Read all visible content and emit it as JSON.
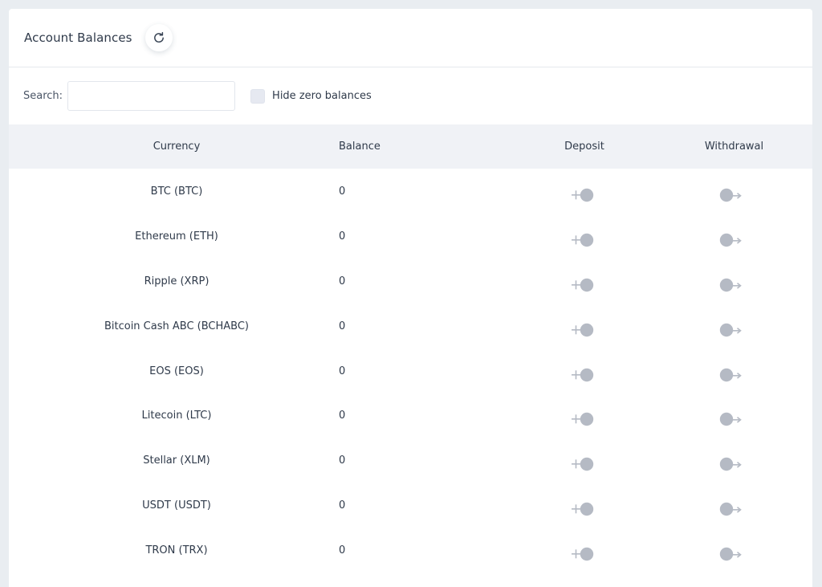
{
  "header": {
    "title": "Account Balances",
    "refresh_icon": "refresh-icon"
  },
  "filters": {
    "search_label": "Search:",
    "search_value": "",
    "search_placeholder": "",
    "hide_zero_label": "Hide zero balances",
    "hide_zero_checked": false
  },
  "table": {
    "columns": [
      "Currency",
      "Balance",
      "Deposit",
      "Withdrawal"
    ],
    "rows": [
      {
        "currency": "BTC (BTC)",
        "balance": "0"
      },
      {
        "currency": "Ethereum (ETH)",
        "balance": "0"
      },
      {
        "currency": "Ripple (XRP)",
        "balance": "0"
      },
      {
        "currency": "Bitcoin Cash ABC (BCHABC)",
        "balance": "0"
      },
      {
        "currency": "EOS (EOS)",
        "balance": "0"
      },
      {
        "currency": "Litecoin (LTC)",
        "balance": "0"
      },
      {
        "currency": "Stellar (XLM)",
        "balance": "0"
      },
      {
        "currency": "USDT (USDT)",
        "balance": "0"
      },
      {
        "currency": "TRON (TRX)",
        "balance": "0"
      }
    ],
    "deposit_icon": "deposit-icon",
    "withdrawal_icon": "withdrawal-icon"
  },
  "colors": {
    "page_background": "#e9edf1",
    "card_background": "#ffffff",
    "table_header_background": "#f0f2f6",
    "text": "#2f3a4a",
    "icon_gray": "#b5bac4"
  }
}
